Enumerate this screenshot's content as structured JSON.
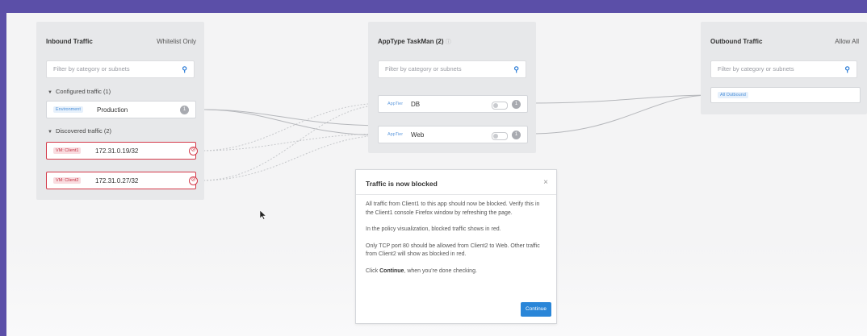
{
  "inbound": {
    "title": "Inbound Traffic",
    "mode": "Whitelist Only",
    "filter_placeholder": "Filter by category or subnets",
    "configured_label": "Configured traffic (1)",
    "discovered_label": "Discovered traffic (2)",
    "configured": [
      {
        "tag": "Environment",
        "label": "Production",
        "count": "1"
      }
    ],
    "discovered": [
      {
        "tag": "VM: Client1",
        "label": "172.31.0.19/32"
      },
      {
        "tag": "VM: Client2",
        "label": "172.31.0.27/32"
      }
    ]
  },
  "apptype": {
    "title": "AppType TaskMan (2)",
    "filter_placeholder": "Filter by category or subnets",
    "items": [
      {
        "tag": "AppTier",
        "label": "DB",
        "count": "1"
      },
      {
        "tag": "AppTier",
        "label": "Web",
        "count": "1"
      }
    ]
  },
  "outbound": {
    "title": "Outbound Traffic",
    "mode": "Allow All",
    "filter_placeholder": "Filter by category or subnets",
    "item": "All Outbound"
  },
  "modal": {
    "title": "Traffic is now blocked",
    "close": "×",
    "p1": "All traffic from Client1 to this app should now be blocked. Verify this in the Client1 console Firefox window by refreshing the page.",
    "p2": "In the policy visualization, blocked traffic shows in red.",
    "p3": "Only TCP port 80 should be allowed from Client2 to Web. Other traffic from Client2 will show as blocked in red.",
    "p4_pre": "Click ",
    "p4_bold": "Continue",
    "p4_post": ", when you're done checking.",
    "button": "Continue"
  },
  "icons": {
    "search": "search-icon",
    "help": "help-icon",
    "blocked": "blocked-icon",
    "close": "close-icon",
    "cursor": "mouse-cursor-icon"
  },
  "colors": {
    "frame": "#5b4fa8",
    "blocked": "#d43a4a",
    "primary": "#2a86d8"
  }
}
